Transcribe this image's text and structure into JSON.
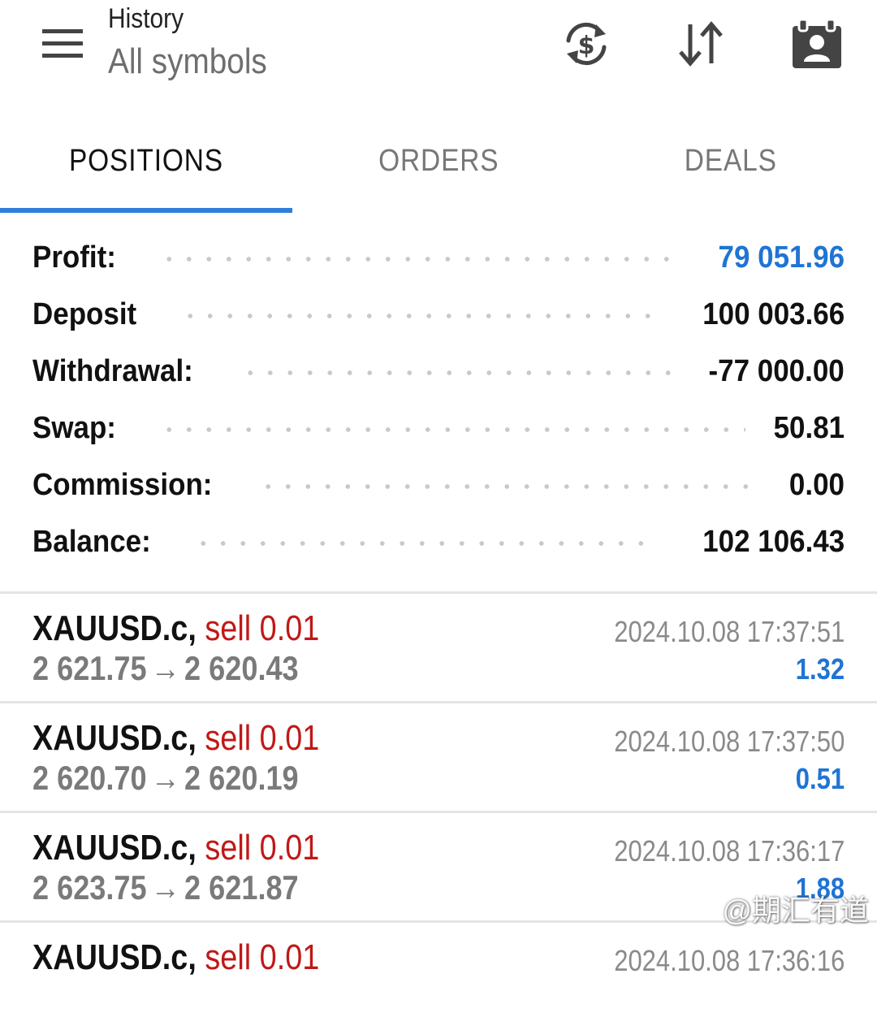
{
  "header": {
    "title": "History",
    "subtitle": "All symbols",
    "icons": [
      "menu-icon",
      "currency-exchange-icon",
      "sort-icon",
      "calendar-user-icon"
    ]
  },
  "tabs": [
    {
      "label": "POSITIONS",
      "active": true
    },
    {
      "label": "ORDERS",
      "active": false
    },
    {
      "label": "DEALS",
      "active": false
    }
  ],
  "summary": {
    "profit": {
      "label": "Profit:",
      "value": "79 051.96"
    },
    "deposit": {
      "label": "Deposit",
      "value": "100 003.66"
    },
    "withdrawal": {
      "label": "Withdrawal:",
      "value": "-77 000.00"
    },
    "swap": {
      "label": "Swap:",
      "value": "50.81"
    },
    "commission": {
      "label": "Commission:",
      "value": "0.00"
    },
    "balance": {
      "label": "Balance:",
      "value": "102 106.43"
    }
  },
  "deals": [
    {
      "symbol": "XAUUSD.c,",
      "side": "sell 0.01",
      "open_price": "2 621.75",
      "close_price": "2 620.43",
      "time": "2024.10.08 17:37:51",
      "profit": "1.32"
    },
    {
      "symbol": "XAUUSD.c,",
      "side": "sell 0.01",
      "open_price": "2 620.70",
      "close_price": "2 620.19",
      "time": "2024.10.08 17:37:50",
      "profit": "0.51"
    },
    {
      "symbol": "XAUUSD.c,",
      "side": "sell 0.01",
      "open_price": "2 623.75",
      "close_price": "2 621.87",
      "time": "2024.10.08 17:36:17",
      "profit": "1.88"
    },
    {
      "symbol": "XAUUSD.c,",
      "side": "sell 0.01",
      "open_price": "",
      "close_price": "",
      "time": "2024.10.08 17:36:16",
      "profit": ""
    }
  ],
  "arrow": "→",
  "watermark": "@期汇有道",
  "colors": {
    "accent": "#2f7fd8",
    "profit_blue": "#1f74d4",
    "sell_red": "#c01818",
    "muted_gray": "#7a7a7a"
  }
}
